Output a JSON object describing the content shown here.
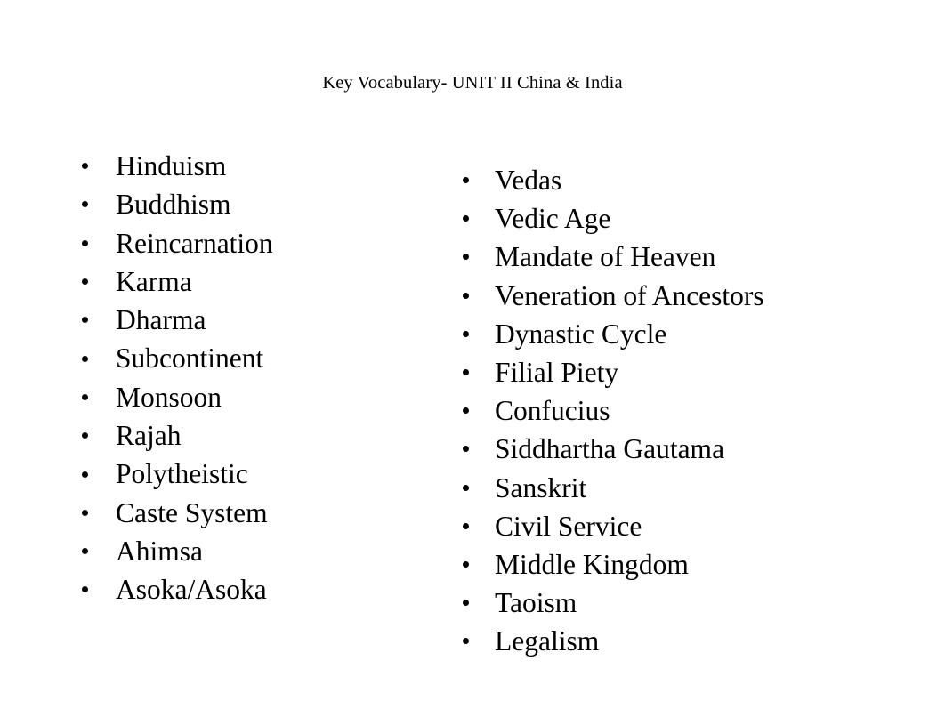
{
  "slide": {
    "title": "Key Vocabulary- UNIT II China & India",
    "background_color": "#ffffff",
    "text_color": "#000000",
    "bullet_glyph": "bullet-disc"
  },
  "columns": {
    "left": {
      "items": [
        {
          "label": "Hinduism"
        },
        {
          "label": "Buddhism"
        },
        {
          "label": "Reincarnation"
        },
        {
          "label": "Karma"
        },
        {
          "label": "Dharma"
        },
        {
          "label": "Subcontinent"
        },
        {
          "label": "Monsoon"
        },
        {
          "label": "Rajah"
        },
        {
          "label": "Polytheistic"
        },
        {
          "label": "Caste System"
        },
        {
          "label": "Ahimsa"
        },
        {
          "label": "Asoka/Asoka"
        }
      ]
    },
    "right": {
      "items": [
        {
          "label": "Vedas"
        },
        {
          "label": "Vedic Age"
        },
        {
          "label": "Mandate of Heaven"
        },
        {
          "label": "Veneration of Ancestors"
        },
        {
          "label": "Dynastic Cycle"
        },
        {
          "label": "Filial Piety"
        },
        {
          "label": "Confucius"
        },
        {
          "label": "Siddhartha Gautama"
        },
        {
          "label": "Sanskrit"
        },
        {
          "label": "Civil Service"
        },
        {
          "label": "Middle Kingdom"
        },
        {
          "label": "Taoism"
        },
        {
          "label": "Legalism"
        }
      ]
    }
  }
}
